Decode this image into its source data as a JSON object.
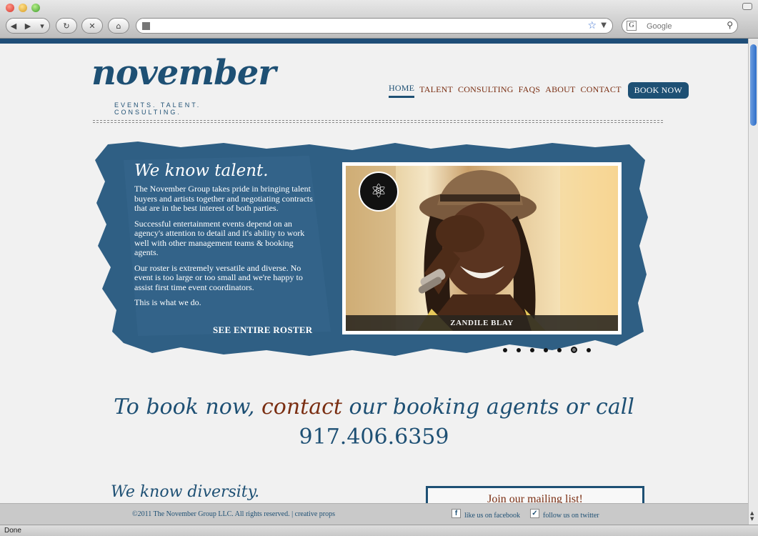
{
  "browser": {
    "search_placeholder": "Google",
    "search_engine_icon": "G",
    "status": "Done"
  },
  "site": {
    "logo_text": "november",
    "logo_tagline": "EVENTS. TALENT. CONSULTING.",
    "nav": [
      {
        "label": "HOME",
        "active": true
      },
      {
        "label": "TALENT"
      },
      {
        "label": "CONSULTING"
      },
      {
        "label": "FAQS"
      },
      {
        "label": "ABOUT"
      },
      {
        "label": "CONTACT"
      }
    ],
    "book_now": "BOOK NOW"
  },
  "hero": {
    "title": "We know talent.",
    "paragraphs": [
      "The November Group takes pride in bringing talent buyers and artists together and negotiating contracts that are in the best interest of both parties.",
      "Successful entertainment events depend on an agency's attention to detail and it's ability to work well with other management teams & booking agents.",
      "Our roster is extremely versatile and diverse. No event is too large or too small and we're happy to assist first time event coordinators.",
      "This is what we do."
    ],
    "roster_link": "SEE ENTIRE ROSTER",
    "caption": "ZANDILE BLAY",
    "slides": 7,
    "active_slide": 6
  },
  "cta": {
    "text_before": "To book now, ",
    "highlight": "contact",
    "text_after": " our booking agents or call",
    "phone": "917.406.6359"
  },
  "diversity": {
    "title": "We know diversity."
  },
  "mailing": {
    "title": "Join our mailing list!"
  },
  "footer": {
    "copyright": "©2011 The November Group LLC. All rights reserved. |",
    "credits": "creative props",
    "facebook": "like us on facebook",
    "twitter": "follow us on twitter"
  },
  "colors": {
    "brand_blue": "#1e5074",
    "accent_rust": "#7a2e12"
  }
}
